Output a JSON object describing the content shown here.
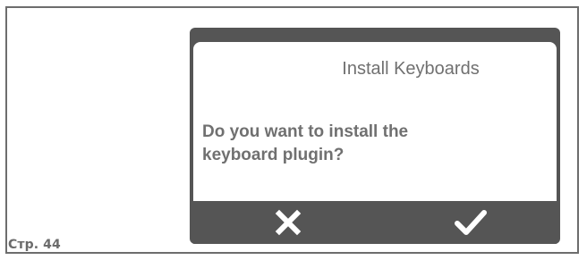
{
  "page": {
    "number_label": "Стр. 44"
  },
  "dialog": {
    "title": "Install Keyboards",
    "message_line1": "Do you want to install the",
    "message_line2": "keyboard plugin?",
    "cancel_icon": "close-icon",
    "confirm_icon": "check-icon"
  },
  "colors": {
    "frame_border": "#6d6d6d",
    "device_background": "#555555",
    "dialog_background": "#ffffff",
    "text": "#707070",
    "icon": "#ffffff"
  }
}
